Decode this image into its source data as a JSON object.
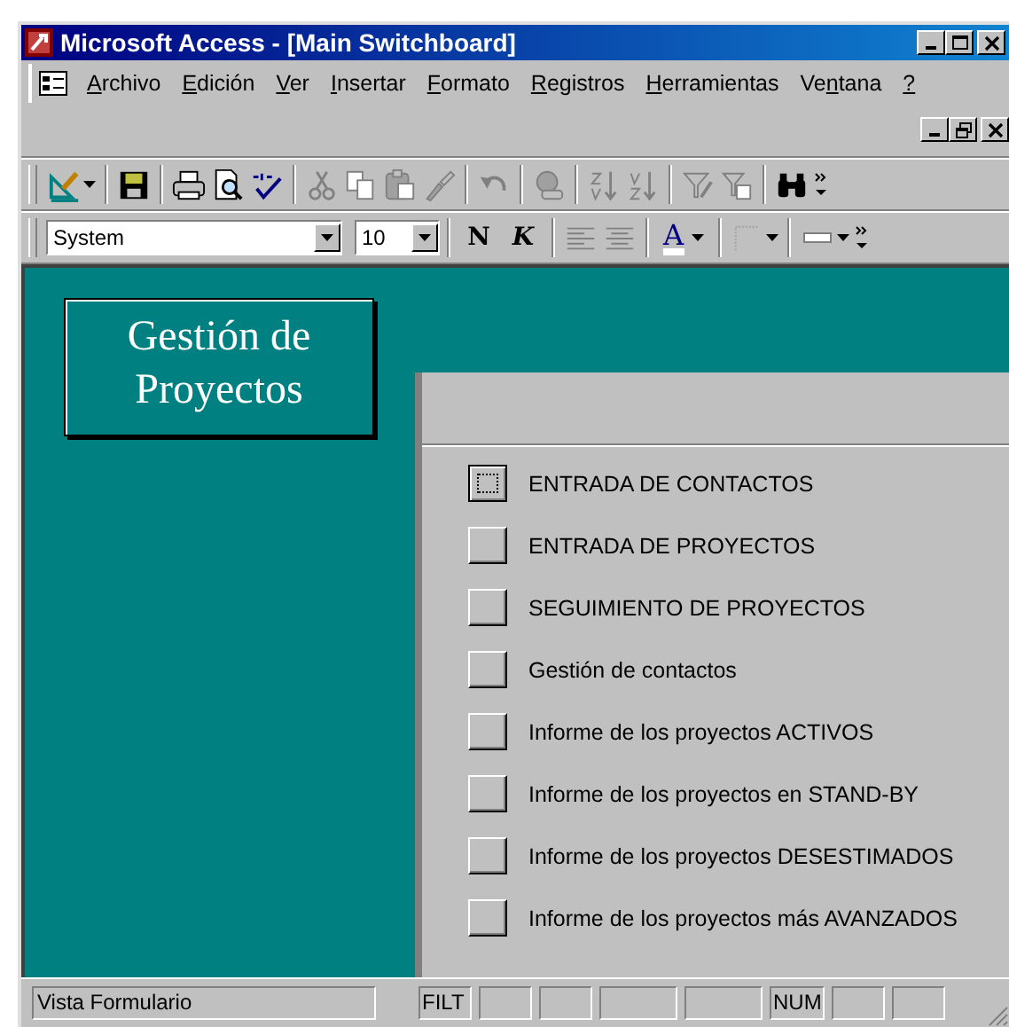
{
  "window": {
    "title": "Microsoft Access - [Main Switchboard]"
  },
  "menu": [
    {
      "key": "A",
      "rest": "rchivo"
    },
    {
      "key": "E",
      "rest": "dición"
    },
    {
      "key": "V",
      "rest": "er"
    },
    {
      "key": "I",
      "rest": "nsertar"
    },
    {
      "key": "F",
      "rest": "ormato"
    },
    {
      "key": "R",
      "rest": "egistros"
    },
    {
      "key": "H",
      "rest": "erramientas"
    },
    {
      "lead": "Ve",
      "key": "n",
      "rest": "tana"
    },
    {
      "key": "?"
    }
  ],
  "toolbar": [
    {
      "kind": "design",
      "dropdown": true,
      "disabled": false
    },
    {
      "kind": "sep"
    },
    {
      "kind": "save",
      "disabled": false
    },
    {
      "kind": "sep"
    },
    {
      "kind": "print",
      "disabled": false
    },
    {
      "kind": "preview",
      "disabled": false
    },
    {
      "kind": "spell",
      "disabled": false
    },
    {
      "kind": "sep"
    },
    {
      "kind": "cut",
      "disabled": true
    },
    {
      "kind": "copy",
      "disabled": true
    },
    {
      "kind": "paste",
      "disabled": true
    },
    {
      "kind": "brush",
      "disabled": true
    },
    {
      "kind": "sep"
    },
    {
      "kind": "undo",
      "disabled": true
    },
    {
      "kind": "sep"
    },
    {
      "kind": "web",
      "disabled": true
    },
    {
      "kind": "sep"
    },
    {
      "kind": "sortasc",
      "disabled": true
    },
    {
      "kind": "sortdesc",
      "disabled": true
    },
    {
      "kind": "sep"
    },
    {
      "kind": "filtersel",
      "disabled": true
    },
    {
      "kind": "filterform",
      "disabled": true
    },
    {
      "kind": "sep"
    },
    {
      "kind": "find",
      "disabled": false
    },
    {
      "kind": "more"
    }
  ],
  "format_bar": {
    "font": "System",
    "size": "10",
    "bold": "N",
    "italic": "K",
    "font_color": "A"
  },
  "switchboard": {
    "title": "Gestión de Proyectos",
    "items": [
      {
        "label": "ENTRADA DE CONTACTOS",
        "focused": true
      },
      {
        "label": "ENTRADA DE PROYECTOS",
        "focused": false
      },
      {
        "label": "SEGUIMIENTO DE PROYECTOS",
        "focused": false
      },
      {
        "label": "Gestión de contactos",
        "focused": false
      },
      {
        "label": "Informe de los proyectos ACTIVOS",
        "focused": false
      },
      {
        "label": "Informe de los proyectos en STAND-BY",
        "focused": false
      },
      {
        "label": "Informe de los proyectos DESESTIMADOS",
        "focused": false
      },
      {
        "label": "Informe de los proyectos más AVANZADOS",
        "focused": false
      }
    ]
  },
  "status_bar": {
    "text": "Vista Formulario",
    "panels": [
      {
        "kind": "text",
        "text": "FILT"
      },
      {
        "kind": "blank"
      },
      {
        "kind": "blank"
      },
      {
        "kind": "wide"
      },
      {
        "kind": "wide"
      },
      {
        "kind": "text",
        "text": "NUM"
      },
      {
        "kind": "blank"
      },
      {
        "kind": "blank"
      }
    ]
  }
}
